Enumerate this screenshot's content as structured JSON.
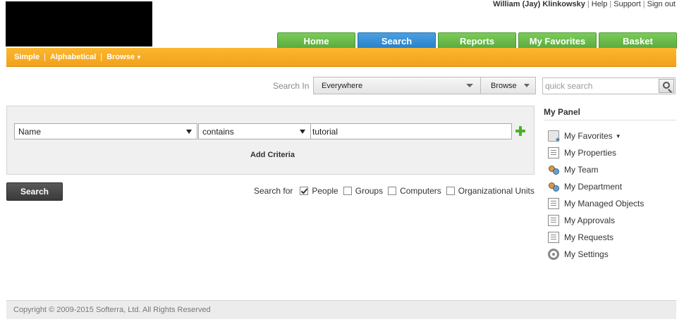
{
  "user": {
    "name": "William (Jay) Klinkowsky",
    "links": [
      "Help",
      "Support",
      "Sign out"
    ]
  },
  "tabs": [
    {
      "label": "Home",
      "active": false
    },
    {
      "label": "Search",
      "active": true
    },
    {
      "label": "Reports",
      "active": false
    },
    {
      "label": "My Favorites",
      "active": false
    },
    {
      "label": "Basket",
      "active": false
    }
  ],
  "subnav": {
    "simple": "Simple",
    "alphabetical": "Alphabetical",
    "browse": "Browse"
  },
  "search_in": {
    "label": "Search In",
    "value": "Everywhere",
    "browse_label": "Browse"
  },
  "quick_search": {
    "placeholder": "quick search"
  },
  "criteria": {
    "field": "Name",
    "operator": "contains",
    "value": "tutorial",
    "add_label": "Add Criteria"
  },
  "search_button": "Search",
  "search_for": {
    "label": "Search for",
    "options": [
      {
        "label": "People",
        "checked": true
      },
      {
        "label": "Groups",
        "checked": false
      },
      {
        "label": "Computers",
        "checked": false
      },
      {
        "label": "Organizational Units",
        "checked": false
      }
    ]
  },
  "my_panel": {
    "title": "My Panel",
    "items": [
      {
        "label": "My Favorites",
        "icon": "favorites-folder-icon"
      },
      {
        "label": "My Properties",
        "icon": "properties-icon"
      },
      {
        "label": "My Team",
        "icon": "team-icon"
      },
      {
        "label": "My Department",
        "icon": "department-icon"
      },
      {
        "label": "My Managed Objects",
        "icon": "managed-objects-icon"
      },
      {
        "label": "My Approvals",
        "icon": "approvals-icon"
      },
      {
        "label": "My Requests",
        "icon": "requests-icon"
      },
      {
        "label": "My Settings",
        "icon": "settings-icon"
      }
    ]
  },
  "footer": "Copyright © 2009-2015 Softerra, Ltd. All Rights Reserved",
  "colors": {
    "tab_green": "#5aaa3c",
    "tab_active_blue": "#2980c9",
    "orange_bar": "#f2a11b",
    "search_button": "#3a3a3a"
  }
}
